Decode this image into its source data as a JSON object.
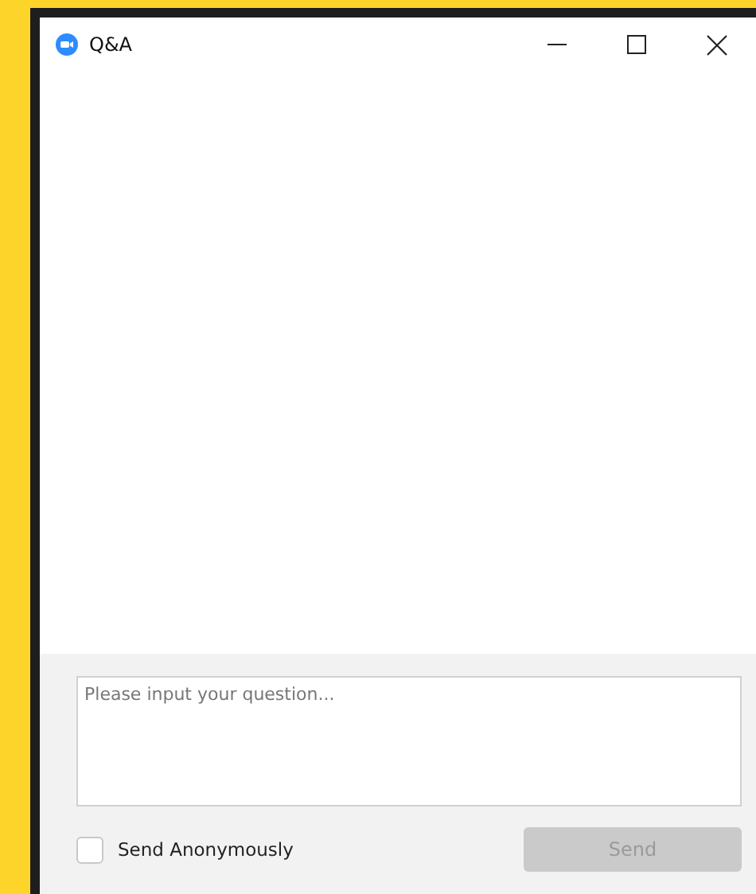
{
  "window": {
    "title": "Q&A"
  },
  "question_field": {
    "placeholder": "Please input your question..."
  },
  "anonymous_checkbox": {
    "label": "Send Anonymously",
    "checked": false
  },
  "send_button": {
    "label": "Send",
    "disabled": true
  }
}
